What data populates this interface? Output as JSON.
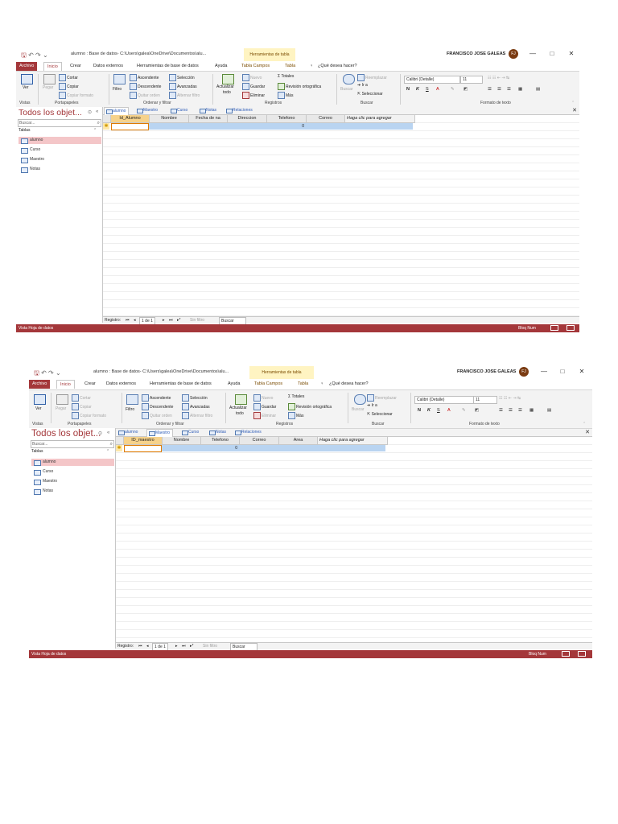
{
  "windows": [
    {
      "title": "alumno : Base de datos- C:\\Users\\galea\\OneDrive\\Documentos\\alu...",
      "context_tab": "Herramientas de tabla",
      "user": "FRANCISCO JOSE GALEAS",
      "avatar": "FJ",
      "minimize": "—",
      "restore": "□",
      "close": "✕",
      "menu": [
        "Archivo",
        "Inicio",
        "Crear",
        "Datos externos",
        "Herramientas de base de datos",
        "Ayuda",
        "Tabla Campos",
        "Tabla"
      ],
      "tell_me": "¿Qué desea hacer?",
      "ribbon": {
        "ver": "Ver",
        "pegar": "Pegar",
        "cortar": "Cortar",
        "copiar": "Copiar",
        "copiar_formato": "Copiar formato",
        "filtro": "Filtro",
        "ascendente": "Ascendente",
        "descendente": "Descendente",
        "quitar_orden": "Quitar orden",
        "seleccion": "Selección",
        "avanzadas": "Avanzadas",
        "alternar_filtro": "Alternar filtro",
        "actualizar": "Actualizar",
        "todo": "todo",
        "nuevo": "Nuevo",
        "guardar": "Guardar",
        "eliminar": "Eliminar",
        "totales": "Totales",
        "revision": "Revisión ortográfica",
        "mas": "Más",
        "buscar_btn": "Buscar",
        "reemplazar": "Reemplazar",
        "ir_a": "Ir a",
        "seleccionar": "Seleccionar",
        "font_name": "Calibri (Detalle)",
        "font_size": "11",
        "bold": "N",
        "italic": "K",
        "underline": "S",
        "groups": [
          "Vistas",
          "Portapapeles",
          "Ordenar y filtrar",
          "Registros",
          "Buscar",
          "Formato de texto"
        ]
      },
      "nav": {
        "title": "Todos los objet...",
        "search_placeholder": "Buscar...",
        "section": "Tablas",
        "items": [
          "alumno",
          "Curso",
          "Maestro",
          "Notas"
        ],
        "selected": "alumno"
      },
      "doc_tabs": [
        "alumno",
        "Maestro",
        "Curso",
        "Notas",
        "Relaciones"
      ],
      "active_tab": "alumno",
      "grid": {
        "columns": [
          "Id_Alumno",
          "Nombre",
          "Fecha de na",
          "Direccion",
          "Telefono",
          "Correo",
          "Haga clic para agregar"
        ],
        "rows": [
          [
            "",
            "",
            "",
            "",
            "0",
            "",
            ""
          ]
        ]
      },
      "record_bar": {
        "label": "Registro:",
        "nav_first": "⏮",
        "nav_prev": "◂",
        "position": "1 de 1",
        "nav_next": "▸",
        "nav_last": "⏭",
        "nav_new": "▸*",
        "filter": "Sin filtro",
        "search": "Buscar"
      },
      "status": {
        "left": "Vista Hoja de datos",
        "right": "Bloq Num"
      }
    },
    {
      "title": "alumno : Base de datos- C:\\Users\\galea\\OneDrive\\Documentos\\alu...",
      "context_tab": "Herramientas de tabla",
      "user": "FRANCISCO JOSE GALEAS",
      "avatar": "FJ",
      "minimize": "—",
      "restore": "□",
      "close": "✕",
      "menu": [
        "Archivo",
        "Inicio",
        "Crear",
        "Datos externos",
        "Herramientas de base de datos",
        "Ayuda",
        "Tabla Campos",
        "Tabla"
      ],
      "tell_me": "¿Qué desea hacer?",
      "ribbon": {
        "ver": "Ver",
        "pegar": "Pegar",
        "cortar": "Cortar",
        "copiar": "Copiar",
        "copiar_formato": "Copiar formato",
        "filtro": "Filtro",
        "ascendente": "Ascendente",
        "descendente": "Descendente",
        "quitar_orden": "Quitar orden",
        "seleccion": "Selección",
        "avanzadas": "Avanzadas",
        "alternar_filtro": "Alternar filtro",
        "actualizar": "Actualizar",
        "todo": "todo",
        "nuevo": "Nuevo",
        "guardar": "Guardar",
        "eliminar": "Eliminar",
        "totales": "Totales",
        "revision": "Revisión ortográfica",
        "mas": "Más",
        "buscar_btn": "Buscar",
        "reemplazar": "Reemplazar",
        "ir_a": "Ir a",
        "seleccionar": "Seleccionar",
        "font_name": "Calibri (Detalle)",
        "font_size": "11",
        "bold": "N",
        "italic": "K",
        "underline": "S",
        "groups": [
          "Vistas",
          "Portapapeles",
          "Ordenar y filtrar",
          "Registros",
          "Buscar",
          "Formato de texto"
        ]
      },
      "nav": {
        "title": "Todos los objet...",
        "search_placeholder": "Buscar...",
        "section": "Tablas",
        "items": [
          "alumno",
          "Curso",
          "Maestro",
          "Notas"
        ],
        "selected": "alumno"
      },
      "doc_tabs": [
        "alumno",
        "Maestro",
        "Curso",
        "Notas",
        "Relaciones"
      ],
      "active_tab": "Maestro",
      "grid": {
        "columns": [
          "ID_maestro",
          "Nombre",
          "Telefono",
          "Correo",
          "Area",
          "Haga clic para agregar"
        ],
        "rows": [
          [
            "",
            "",
            "0",
            "",
            "",
            ""
          ]
        ]
      },
      "record_bar": {
        "label": "Registro:",
        "nav_first": "⏮",
        "nav_prev": "◂",
        "position": "1 de 1",
        "nav_next": "▸",
        "nav_last": "⏭",
        "nav_new": "▸*",
        "filter": "Sin filtro",
        "search": "Buscar"
      },
      "status": {
        "left": "Vista Hoja de datos",
        "right": "Bloq Num"
      }
    }
  ]
}
